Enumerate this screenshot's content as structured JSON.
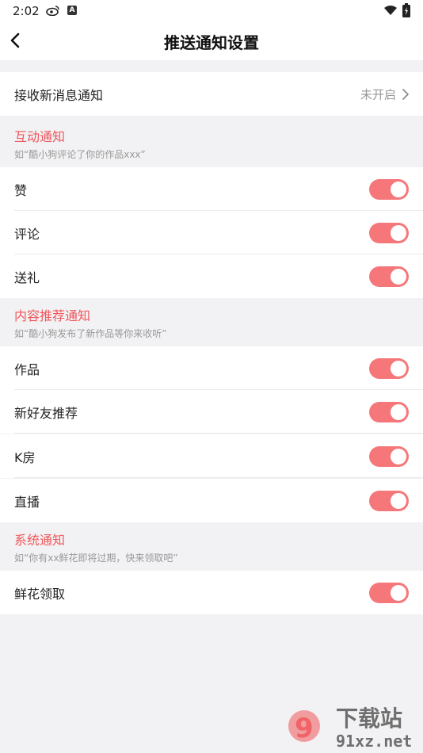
{
  "status_bar": {
    "time": "2:02",
    "a_badge": "A"
  },
  "header": {
    "title": "推送通知设置"
  },
  "receive": {
    "label": "接收新消息通知",
    "value": "未开启"
  },
  "sections": [
    {
      "title": "互动通知",
      "subtitle": "如“酷小狗评论了你的作品xxx”",
      "items": [
        {
          "label": "赞",
          "on": true
        },
        {
          "label": "评论",
          "on": true
        },
        {
          "label": "送礼",
          "on": true
        }
      ]
    },
    {
      "title": "内容推荐通知",
      "subtitle": "如“酷小狗发布了新作品等你来收听”",
      "items": [
        {
          "label": "作品",
          "on": true
        },
        {
          "label": "新好友推荐",
          "on": true
        },
        {
          "label": "K房",
          "on": true
        },
        {
          "label": "直播",
          "on": true
        }
      ]
    },
    {
      "title": "系统通知",
      "subtitle": "如“你有xx鲜花即将过期，快来领取吧”",
      "items": [
        {
          "label": "鲜花领取",
          "on": true
        }
      ]
    }
  ],
  "watermark": {
    "text_top": "下载站",
    "text_bottom": "91xz.net"
  },
  "colors": {
    "accent": "#f0565a",
    "toggle_on": "#f5777a"
  }
}
